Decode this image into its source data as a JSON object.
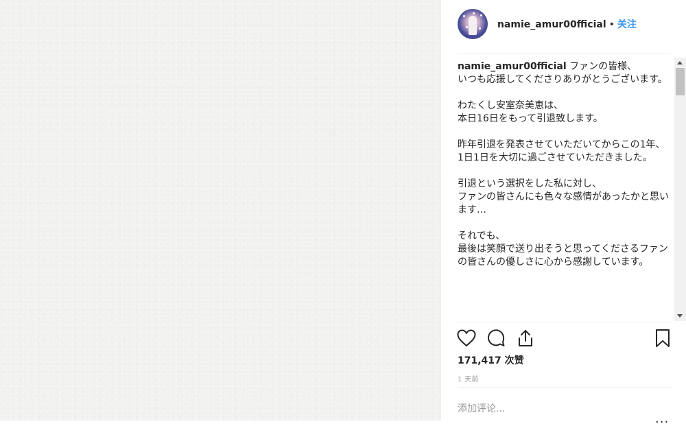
{
  "post": {
    "username": "namie_amur00fficial",
    "separator": "•",
    "follow_label": "关注"
  },
  "caption": {
    "author": "namie_amur00fficial",
    "paragraphs": [
      "ファンの皆様、\nいつも応援してくださりありがとうございます。",
      "わたくし安室奈美恵は、\n本日16日をもって引退致します。",
      "昨年引退を発表させていただいてからこの1年、\n1日1日を大切に過ごさせていただきました。",
      "引退という選択をした私に対し、\nファンの皆さんにも色々な感情があったかと思います…",
      "それでも、\n最後は笑顔で送り出そうと思ってくださるファンの皆さんの優しさに心から感謝しています。"
    ]
  },
  "actions": {
    "like_icon": "heart-icon",
    "comment_icon": "comment-bubble-icon",
    "share_icon": "share-icon",
    "save_icon": "bookmark-icon"
  },
  "stats": {
    "likes": "171,417 次赞",
    "time": "1 天前"
  },
  "comment_box": {
    "placeholder": "添加评论...",
    "more": "..."
  }
}
